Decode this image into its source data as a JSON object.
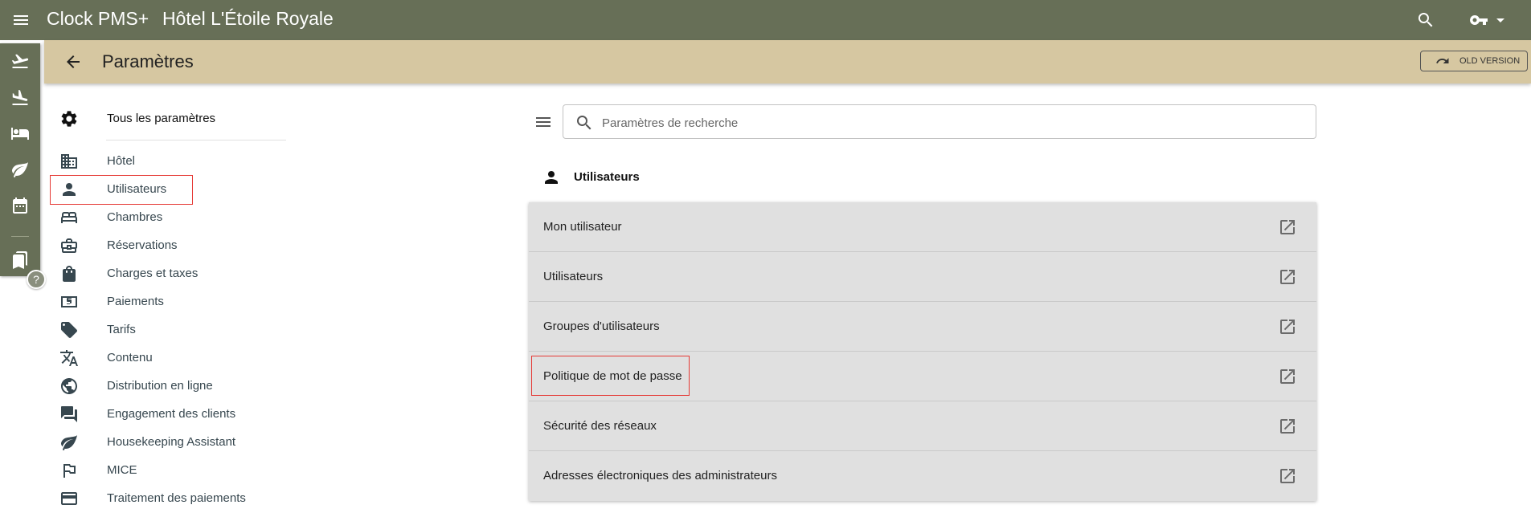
{
  "app": {
    "name": "Clock PMS+",
    "hotel": "Hôtel L'Étoile Royale"
  },
  "header": {
    "title": "Paramètres",
    "old_version_label": "OLD VERSION"
  },
  "rail": {
    "help_label": "?"
  },
  "sidebar": {
    "all_label": "Tous les paramètres",
    "items": [
      {
        "label": "Hôtel",
        "icon": "building-icon"
      },
      {
        "label": "Utilisateurs",
        "icon": "person-icon"
      },
      {
        "label": "Chambres",
        "icon": "bed-icon"
      },
      {
        "label": "Réservations",
        "icon": "briefcase-icon"
      },
      {
        "label": "Charges et taxes",
        "icon": "shopping-bag-icon"
      },
      {
        "label": "Paiements",
        "icon": "dollar-icon"
      },
      {
        "label": "Tarifs",
        "icon": "tag-icon"
      },
      {
        "label": "Contenu",
        "icon": "translate-icon"
      },
      {
        "label": "Distribution en ligne",
        "icon": "globe-icon"
      },
      {
        "label": "Engagement des clients",
        "icon": "chat-icon"
      },
      {
        "label": "Housekeeping Assistant",
        "icon": "leaf-icon"
      },
      {
        "label": "MICE",
        "icon": "flag-icon"
      },
      {
        "label": "Traitement des paiements",
        "icon": "credit-card-icon"
      }
    ]
  },
  "search": {
    "placeholder": "Paramètres de recherche",
    "value": ""
  },
  "section": {
    "title": "Utilisateurs",
    "rows": [
      {
        "label": "Mon utilisateur"
      },
      {
        "label": "Utilisateurs"
      },
      {
        "label": "Groupes d'utilisateurs"
      },
      {
        "label": "Politique de mot de passe"
      },
      {
        "label": "Sécurité des réseaux"
      },
      {
        "label": "Adresses électroniques des administrateurs"
      }
    ]
  },
  "colors": {
    "topbar": "#676f57",
    "subheader": "#d6c7a1",
    "highlight": "#e53935",
    "card": "#e0e0e0"
  }
}
